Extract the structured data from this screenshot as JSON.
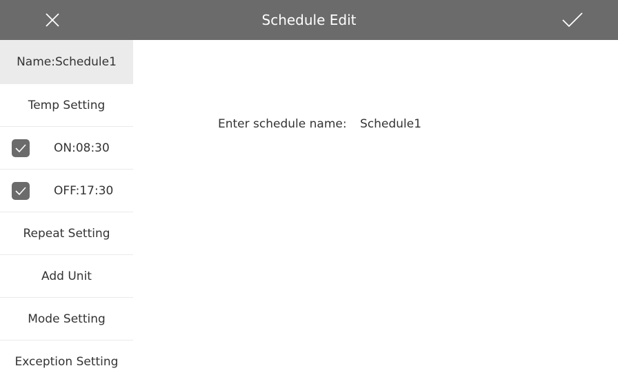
{
  "header": {
    "title": "Schedule Edit",
    "close_icon": "close-icon",
    "confirm_icon": "checkmark-icon"
  },
  "sidebar": {
    "items": [
      {
        "label": "Name:Schedule1",
        "active": true
      },
      {
        "label": "Temp Setting"
      },
      {
        "label": "ON:08:30",
        "checked": true
      },
      {
        "label": "OFF:17:30",
        "checked": true
      },
      {
        "label": "Repeat Setting"
      },
      {
        "label": "Add Unit"
      },
      {
        "label": "Mode Setting"
      },
      {
        "label": "Exception Setting"
      }
    ]
  },
  "main": {
    "name_prompt": "Enter schedule name:",
    "name_value": "Schedule1"
  },
  "colors": {
    "header_bg": "#6b6b6b",
    "active_item_bg": "#ebebeb",
    "checkbox_bg": "#6b6b6b"
  }
}
